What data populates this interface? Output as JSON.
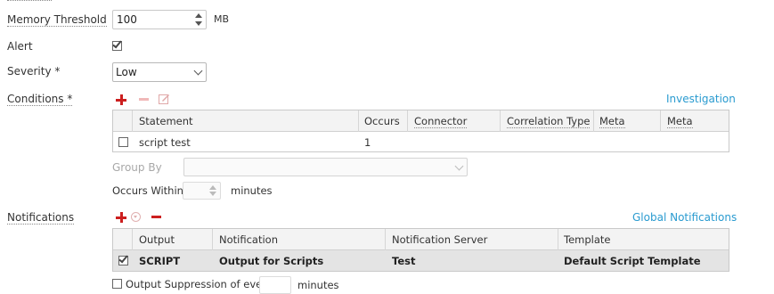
{
  "memory_threshold": {
    "label": "Memory Threshold",
    "value": "100",
    "unit": "MB"
  },
  "alert": {
    "label": "Alert",
    "checked": true
  },
  "severity": {
    "label": "Severity *",
    "value": "Low"
  },
  "conditions": {
    "label": "Conditions *",
    "investigation_link": "Investigation",
    "columns": [
      "Statement",
      "Occurs",
      "Connector",
      "Correlation Type",
      "Meta",
      "Meta"
    ],
    "rows": [
      {
        "checked": false,
        "statement": "script test",
        "occurs": "1",
        "connector": "",
        "correlation_type": "",
        "meta1": "",
        "meta2": ""
      }
    ],
    "group_by": {
      "label": "Group By",
      "value": ""
    },
    "occurs_within": {
      "label": "Occurs Within",
      "value": "",
      "unit": "minutes"
    }
  },
  "notifications": {
    "label": "Notifications",
    "global_link": "Global Notifications",
    "columns": [
      "Output",
      "Notification",
      "Notification Server",
      "Template"
    ],
    "rows": [
      {
        "checked": true,
        "output": "SCRIPT",
        "notification": "Output for Scripts",
        "server": "Test",
        "template": "Default Script Template"
      }
    ],
    "suppression": {
      "label": "Output Suppression of every",
      "value": "",
      "unit": "minutes",
      "checked": false
    }
  }
}
